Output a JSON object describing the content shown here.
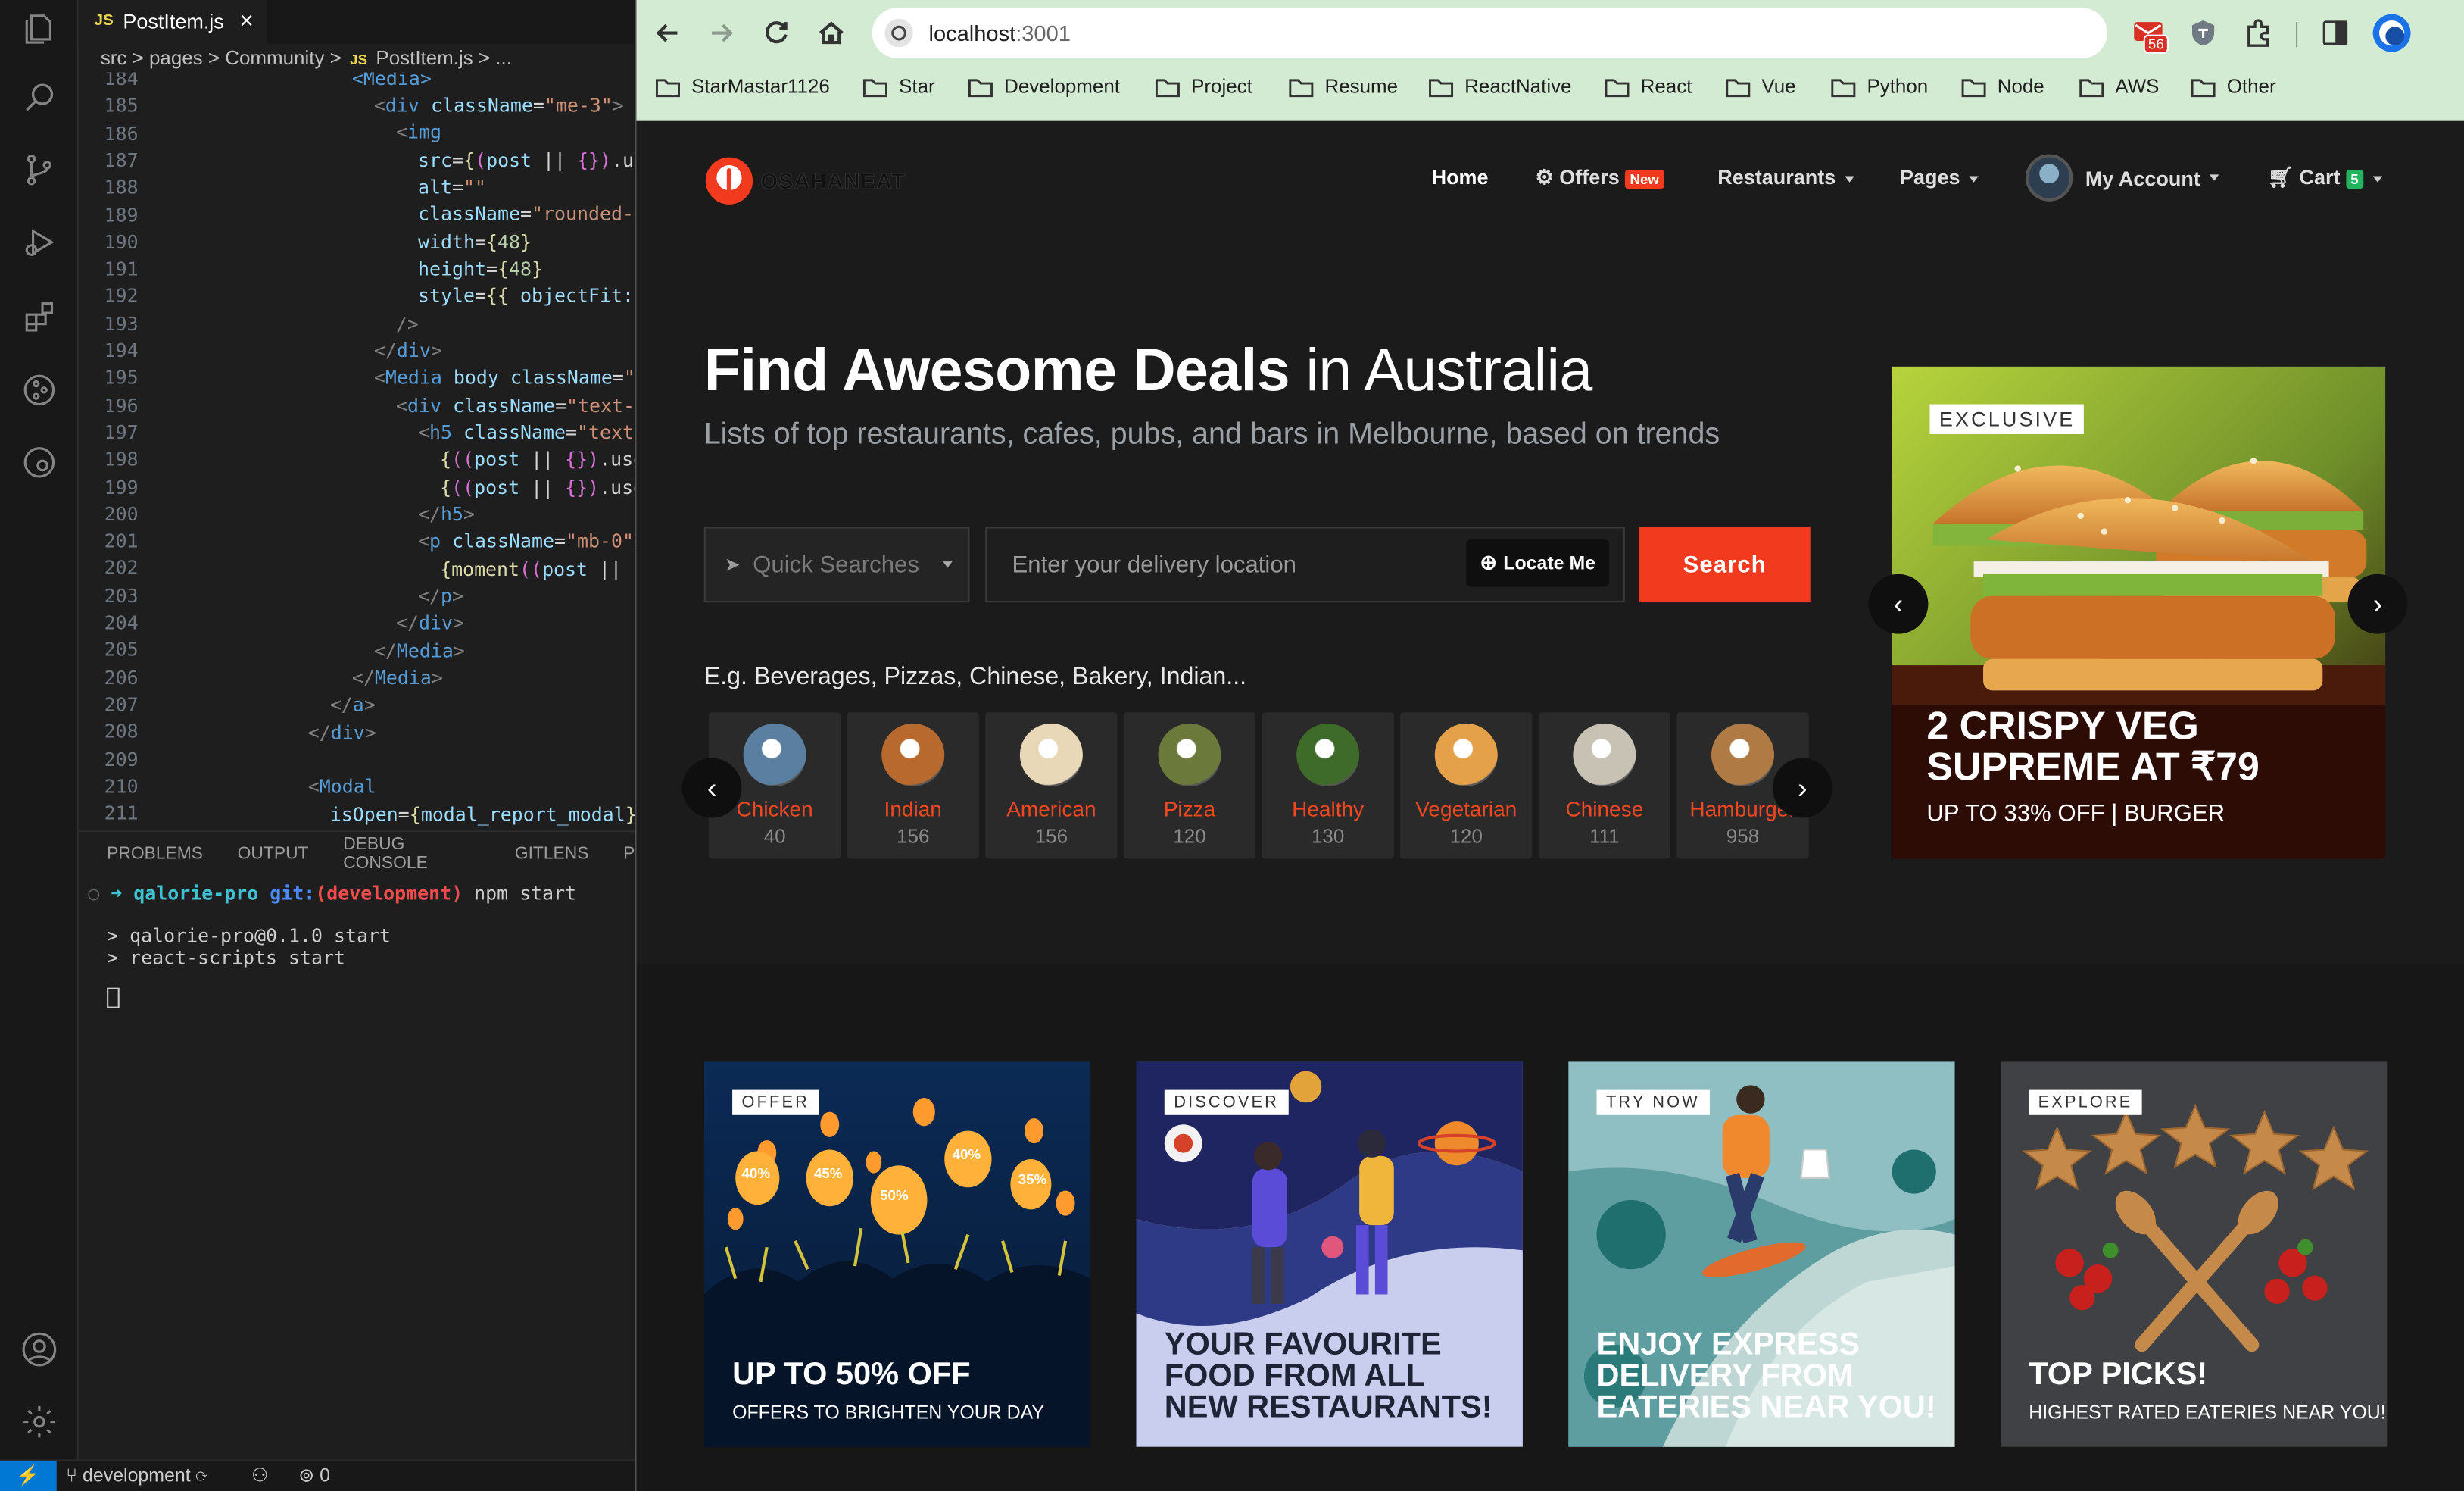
{
  "editor": {
    "tab_lang": "JS",
    "tab_title": "PostItem.js",
    "tab_close": "×",
    "breadcrumb": [
      "src",
      "pages",
      "Community",
      "JS",
      "PostItem.js",
      "..."
    ],
    "line_numbers": [
      "184",
      "185",
      "186",
      "187",
      "188",
      "189",
      "190",
      "191",
      "192",
      "193",
      "194",
      "195",
      "196",
      "197",
      "198",
      "199",
      "200",
      "201",
      "202",
      "203",
      "204",
      "205",
      "206",
      "207",
      "208",
      "209",
      "210",
      "211"
    ],
    "panel_tabs": [
      "PROBLEMS",
      "OUTPUT",
      "DEBUG CONSOLE",
      "GITLENS",
      "P"
    ],
    "terminal": {
      "project": "qalorie-pro",
      "git": "git:",
      "branch": "(development)",
      "command": "npm start",
      "out1": "> qalorie-pro@0.1.0 start",
      "out2": "> react-scripts start"
    },
    "status": {
      "branch": "development",
      "ports": "0"
    }
  },
  "browser": {
    "url_host": "localhost",
    "url_port": ":3001",
    "ext_badge": "56",
    "bookmarks": [
      "StarMastar1126",
      "Star",
      "Development",
      "Project",
      "Resume",
      "ReactNative",
      "React",
      "Vue",
      "Python",
      "Node",
      "AWS",
      "Other"
    ]
  },
  "site": {
    "logo": "OSAHANEAT",
    "nav": {
      "home": "Home",
      "offers": "Offers",
      "offers_badge": "New",
      "restaurants": "Restaurants",
      "pages": "Pages",
      "account": "My Account",
      "cart": "Cart",
      "cart_count": "5"
    },
    "hero_bold": "Find Awesome Deals",
    "hero_rest": " in Australia",
    "subtitle": "Lists of top restaurants, cafes, pubs, and bars in Melbourne, based on trends",
    "quick_search": "Quick Searches",
    "location_placeholder": "Enter your delivery location",
    "locate_me": "Locate Me",
    "search": "Search",
    "examples": "E.g. Beverages, Pizzas, Chinese, Bakery, Indian...",
    "categories": [
      {
        "name": "Chicken",
        "count": "40"
      },
      {
        "name": "Indian",
        "count": "156"
      },
      {
        "name": "American",
        "count": "156"
      },
      {
        "name": "Pizza",
        "count": "120"
      },
      {
        "name": "Healthy",
        "count": "130"
      },
      {
        "name": "Vegetarian",
        "count": "120"
      },
      {
        "name": "Chinese",
        "count": "111"
      },
      {
        "name": "Hamburger",
        "count": "958"
      }
    ],
    "banner": {
      "tag": "EXCLUSIVE",
      "title1": "2 CRISPY VEG",
      "title2": "SUPREME AT ₹79",
      "sub": "UP TO 33% OFF | BURGER"
    },
    "cards": [
      {
        "tag": "OFFER",
        "title": [
          "UP TO 50% OFF"
        ],
        "sub": "OFFERS TO BRIGHTEN YOUR DAY"
      },
      {
        "tag": "DISCOVER",
        "title": [
          "YOUR FAVOURITE",
          "FOOD FROM ALL",
          "NEW RESTAURANTS!"
        ],
        "sub": ""
      },
      {
        "tag": "TRY NOW",
        "title": [
          "ENJOY EXPRESS",
          "DELIVERY FROM",
          "EATERIES NEAR YOU!"
        ],
        "sub": ""
      },
      {
        "tag": "EXPLORE",
        "title": [
          "TOP PICKS!"
        ],
        "sub": "HIGHEST RATED EATERIES NEAR YOU!"
      }
    ],
    "lantern_pcts": [
      "40%",
      "45%",
      "50%",
      "40%",
      "35%"
    ]
  },
  "colors": {
    "accent": "#f23a1e",
    "chrome_bg": "#d3ebd3",
    "vscode_bg": "#1e1e1e"
  }
}
